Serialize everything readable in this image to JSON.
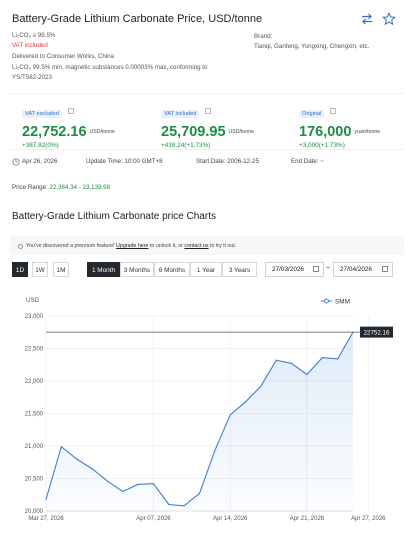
{
  "header": {
    "title": "Battery-Grade Lithium Carbonate Price, USD/tonne",
    "compare_icon": "compare-arrows-icon",
    "favorite_icon": "star-outline-icon"
  },
  "spec": {
    "purity": "Li₂CO₃ ≥ 99.5%",
    "vat": "VAT included",
    "delivery": "Delivered to Consumer Works, China",
    "standard_line1": "Li₂CO₃ 99.5% min, magnetic substances 0.00003% max, conforming to",
    "standard_line2": "YS/T582-2023",
    "brand_label": "Brand:",
    "brand_value": "Tianqi, Ganfeng, Yongxing, Chengxin, etc."
  },
  "prices": [
    {
      "badge": "VAT excluded",
      "price": "22,752.16",
      "unit": "USD/tonne",
      "change": "+387.82(0%)"
    },
    {
      "badge": "VAT included",
      "price": "25,709.95",
      "unit": "USD/tonne",
      "change": "+438.24(+1.73%)"
    },
    {
      "badge": "Original",
      "price": "176,000",
      "unit": "yuan/tonne",
      "change": "+3,000(+1.73%)"
    }
  ],
  "meta": {
    "date": "Apr 26, 2026",
    "update_time": "Update Time: 10:00 GMT+8",
    "start_date": "Start Date: 2006-12-25",
    "end_date": "End Date: ~"
  },
  "price_range": {
    "label": "Price Range:",
    "value": "22,364.34 - 23,139.98"
  },
  "charts_section": {
    "title": "Battery-Grade Lithium Carbonate price Charts",
    "notice_prefix": "You've discovered a premium feature!",
    "notice_link1": "Upgrade here",
    "notice_mid": "to unlock it, or",
    "notice_link2": "contact us",
    "notice_suffix": "to try it out."
  },
  "toolbar": {
    "granularity": [
      "1D",
      "1W",
      "1M"
    ],
    "ranges": [
      "1 Month",
      "3 Months",
      "6 Months",
      "1 Year",
      "3 Years"
    ],
    "active_granularity": "1D",
    "active_range": "1 Month",
    "date_from": "27/03/2026",
    "date_to": "27/04/2026",
    "separator": "~"
  },
  "colors": {
    "accent_green": "#1b8e44",
    "line_blue": "#3b7fd8",
    "badge_blue": "#2f6fd4",
    "vat_red": "#e23b3b"
  },
  "chart_data": {
    "type": "line",
    "ylabel": "USD",
    "legend": "SMM",
    "legend_position": "top-right",
    "ylim": [
      20000,
      23000
    ],
    "yticks": [
      20000,
      20500,
      21000,
      21500,
      22000,
      22500,
      23000
    ],
    "ytick_labels": [
      "20,000",
      "20,500",
      "21,000",
      "21,500",
      "22,000",
      "22,500",
      "23,000"
    ],
    "xtick_labels": [
      "Mar 27, 2026",
      "Apr 07, 2026",
      "Apr 14, 2026",
      "Apr 21, 2026",
      "Apr 27, 2026"
    ],
    "xtick_index": [
      0,
      7,
      12,
      17,
      21
    ],
    "grid": true,
    "current_value": 22752.16,
    "current_value_label": "22752.16",
    "series": [
      {
        "name": "SMM",
        "values": [
          20180,
          20990,
          20800,
          20650,
          20460,
          20300,
          20410,
          20420,
          20100,
          20080,
          20270,
          20930,
          21480,
          21680,
          21920,
          22320,
          22270,
          22100,
          22360,
          22340,
          22752.16
        ]
      }
    ]
  }
}
